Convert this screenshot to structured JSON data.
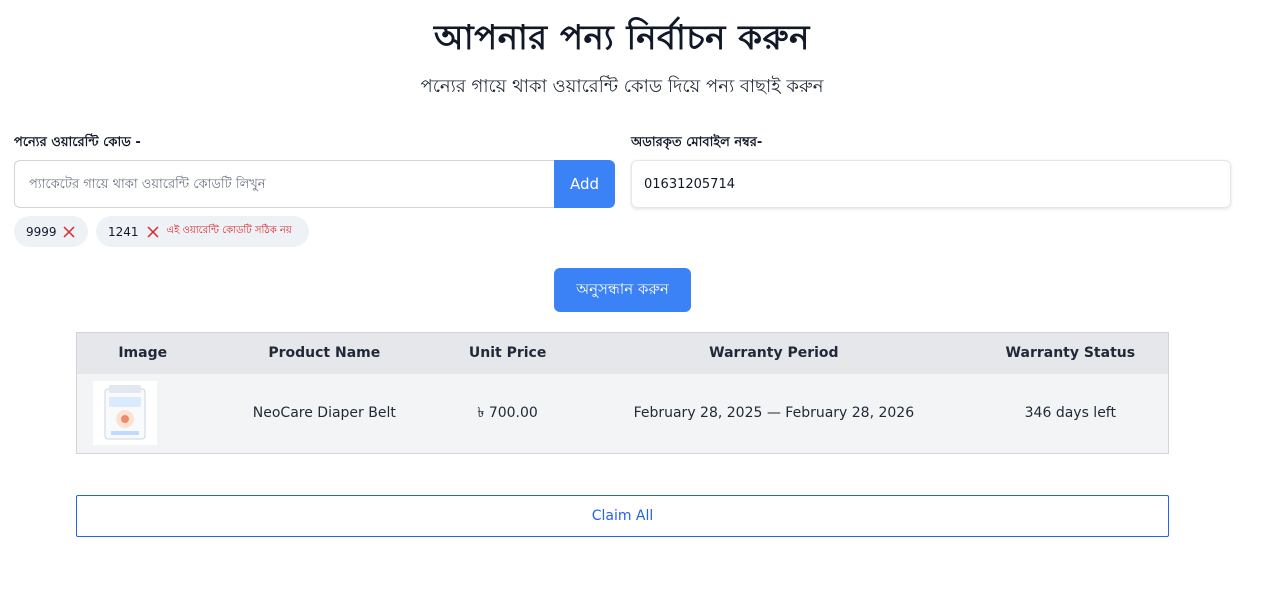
{
  "header": {
    "title": "আপনার পন্য নির্বাচন করুন",
    "subtitle": "পন্যের গায়ে থাকা ওয়ারেন্টি কোড দিয়ে পন্য বাছাই করুন"
  },
  "warranty_code": {
    "label": "পন্যের ওয়ারেন্টি কোড -",
    "placeholder": "প্যাকেটের গায়ে থাকা ওয়ারেন্টি কোডটি লিখুন",
    "value": "",
    "add_label": "Add"
  },
  "mobile": {
    "label": "অডারকৃত মোবাইল নম্বর-",
    "value": "01631205714"
  },
  "codes": [
    {
      "code": "9999",
      "error": ""
    },
    {
      "code": "1241",
      "error": "এই ওয়ারেন্টি কোডটি সঠিক নয়"
    }
  ],
  "search_label": "অনুসন্ধান করুন",
  "table": {
    "headers": [
      "Image",
      "Product Name",
      "Unit Price",
      "Warranty Period",
      "Warranty Status"
    ],
    "rows": [
      {
        "image_icon": "diaper-package-image",
        "name": "NeoCare Diaper Belt",
        "price": "৳ 700.00",
        "period": "February 28, 2025 — February 28, 2026",
        "status": "346 days left"
      }
    ]
  },
  "claim_label": "Claim All",
  "colors": {
    "primary": "#3b82f6",
    "success": "#22a55a",
    "error": "#dc2626"
  }
}
